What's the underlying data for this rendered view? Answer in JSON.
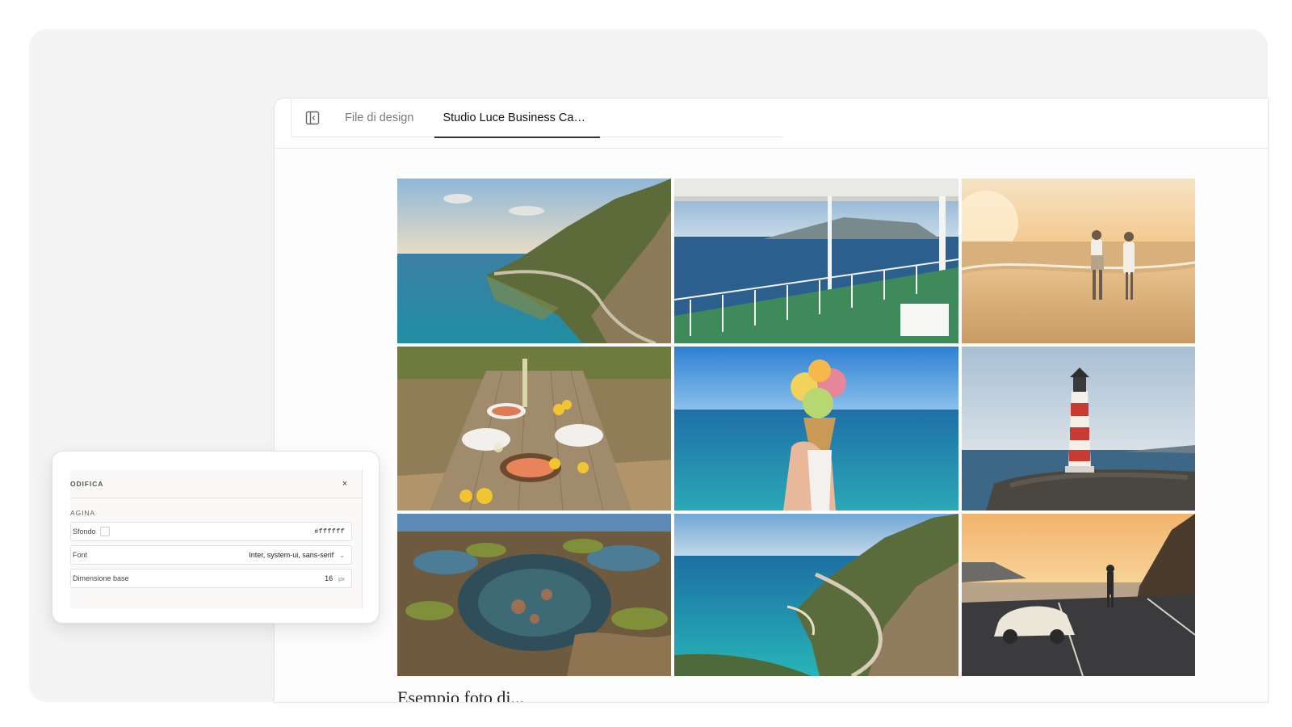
{
  "tabs": {
    "panel_toggle_icon": "sidebar-toggle-icon",
    "items": [
      {
        "label": "File di design",
        "active": false
      },
      {
        "label": "Studio Luce Business Ca…",
        "active": true
      }
    ]
  },
  "gallery": {
    "photos": [
      {
        "subject": "coastal cliff road over turquoise sea"
      },
      {
        "subject": "ferry deck railing with sea view"
      },
      {
        "subject": "couple walking on beach at sunset"
      },
      {
        "subject": "seafood table with lemons and wine"
      },
      {
        "subject": "hand holding gelato cone over sea"
      },
      {
        "subject": "red and white striped lighthouse"
      },
      {
        "subject": "rocky tide pools with seaweed"
      },
      {
        "subject": "winding coast road and blue bay"
      },
      {
        "subject": "vintage convertible car at sunset"
      }
    ],
    "caption": "Esempio foto di..."
  },
  "edit_panel": {
    "title": "ODIFICA",
    "close_label": "×",
    "section_label": "AGINA",
    "fields": {
      "background": {
        "label": "Sfondo",
        "value": "#ffffff"
      },
      "font": {
        "label": "Font",
        "value": "Inter, system-ui, sans-serif"
      },
      "base_size": {
        "label": "Dimensione base",
        "value": "16",
        "unit": "px"
      }
    }
  }
}
